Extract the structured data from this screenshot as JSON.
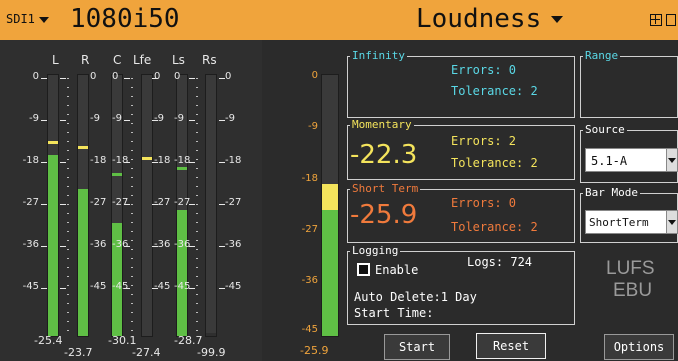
{
  "header": {
    "input": "SDI1",
    "format": "1080i50",
    "title": "Loudness"
  },
  "channels": [
    {
      "label": "L",
      "level": 0.69,
      "peak_color": "#f4e45c",
      "peak_level": 0.73
    },
    {
      "label": "R",
      "level": 0.56,
      "peak_color": "#f4e45c",
      "peak_level": 0.71
    },
    {
      "label": "C",
      "level": 0.43,
      "peak_color": "#5fbf45",
      "peak_level": 0.61
    },
    {
      "label": "Lfe",
      "level": 0.0,
      "peak_color": "#f4e45c",
      "peak_level": 0.67
    },
    {
      "label": "Ls",
      "level": 0.48,
      "peak_color": "#5fbf45",
      "peak_level": 0.63
    },
    {
      "label": "Rs",
      "level": 0.0,
      "peak_color": "#2f2f2f",
      "peak_level": 0.0
    }
  ],
  "scale_ticks": [
    "0",
    "-9",
    "-18",
    "-27",
    "-36",
    "-45"
  ],
  "bottom_values": {
    "row1": [
      "-25.4",
      "-30.1",
      "-28.7"
    ],
    "row2": [
      "-23.7",
      "-27.4",
      "-99.9"
    ]
  },
  "loudness_bar": {
    "ticks": [
      "0",
      "-9",
      "-18",
      "-27",
      "-36",
      "-45"
    ],
    "value": "-25.9",
    "level": 0.48,
    "yellow_top": 0.58
  },
  "infinity": {
    "title": "Infinity",
    "errors": "Errors: 0",
    "tolerance": "Tolerance: 2"
  },
  "range": {
    "title": "Range"
  },
  "momentary": {
    "title": "Momentary",
    "value": "-22.3",
    "errors": "Errors: 2",
    "tolerance": "Tolerance: 2"
  },
  "short_term": {
    "title": "Short Term",
    "value": "-25.9",
    "errors": "Errors: 0",
    "tolerance": "Tolerance: 2"
  },
  "source": {
    "title": "Source",
    "selected": "5.1-A"
  },
  "bar_mode": {
    "title": "Bar Mode",
    "selected": "ShortTerm"
  },
  "logging": {
    "title": "Logging",
    "enable_label": "Enable",
    "logs": "Logs: 724",
    "auto_delete": "Auto Delete:1 Day",
    "start_time": "Start Time:"
  },
  "units": {
    "line1": "LUFS",
    "line2": "EBU"
  },
  "buttons": {
    "start": "Start",
    "reset": "Reset",
    "options": "Options"
  },
  "colors": {
    "accent": "#f0a43c",
    "cyan": "#5ad8e6",
    "yellow": "#f4e45c",
    "orange": "#f07a3c",
    "green": "#5fbf45"
  }
}
